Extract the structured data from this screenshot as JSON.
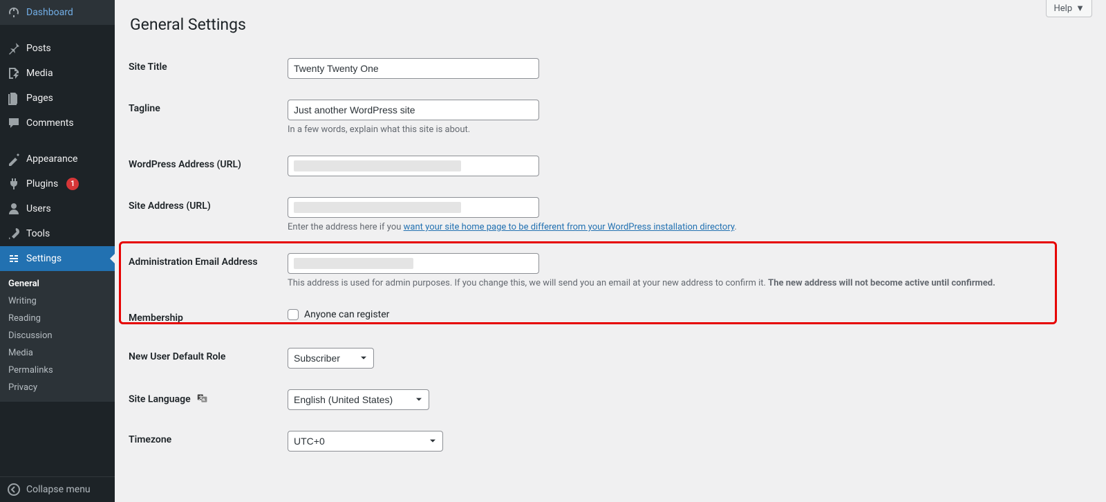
{
  "help_label": "Help",
  "nav": {
    "dashboard": "Dashboard",
    "posts": "Posts",
    "media": "Media",
    "pages": "Pages",
    "comments": "Comments",
    "appearance": "Appearance",
    "plugins": "Plugins",
    "plugins_badge": "1",
    "users": "Users",
    "tools": "Tools",
    "settings": "Settings",
    "collapse": "Collapse menu"
  },
  "submenu": {
    "general": "General",
    "writing": "Writing",
    "reading": "Reading",
    "discussion": "Discussion",
    "media": "Media",
    "permalinks": "Permalinks",
    "privacy": "Privacy"
  },
  "page_title": "General Settings",
  "fields": {
    "site_title_label": "Site Title",
    "site_title_value": "Twenty Twenty One",
    "tagline_label": "Tagline",
    "tagline_value": "Just another WordPress site",
    "tagline_desc": "In a few words, explain what this site is about.",
    "wp_url_label": "WordPress Address (URL)",
    "site_url_label": "Site Address (URL)",
    "site_url_desc_prefix": "Enter the address here if you ",
    "site_url_desc_link": "want your site home page to be different from your WordPress installation directory",
    "admin_email_label": "Administration Email Address",
    "admin_email_desc_a": "This address is used for admin purposes. If you change this, we will send you an email at your new address to confirm it. ",
    "admin_email_desc_b": "The new address will not become active until confirmed.",
    "membership_label": "Membership",
    "membership_checkbox": "Anyone can register",
    "default_role_label": "New User Default Role",
    "default_role_value": "Subscriber",
    "language_label": "Site Language",
    "language_value": "English (United States)",
    "timezone_label": "Timezone",
    "timezone_value": "UTC+0"
  }
}
